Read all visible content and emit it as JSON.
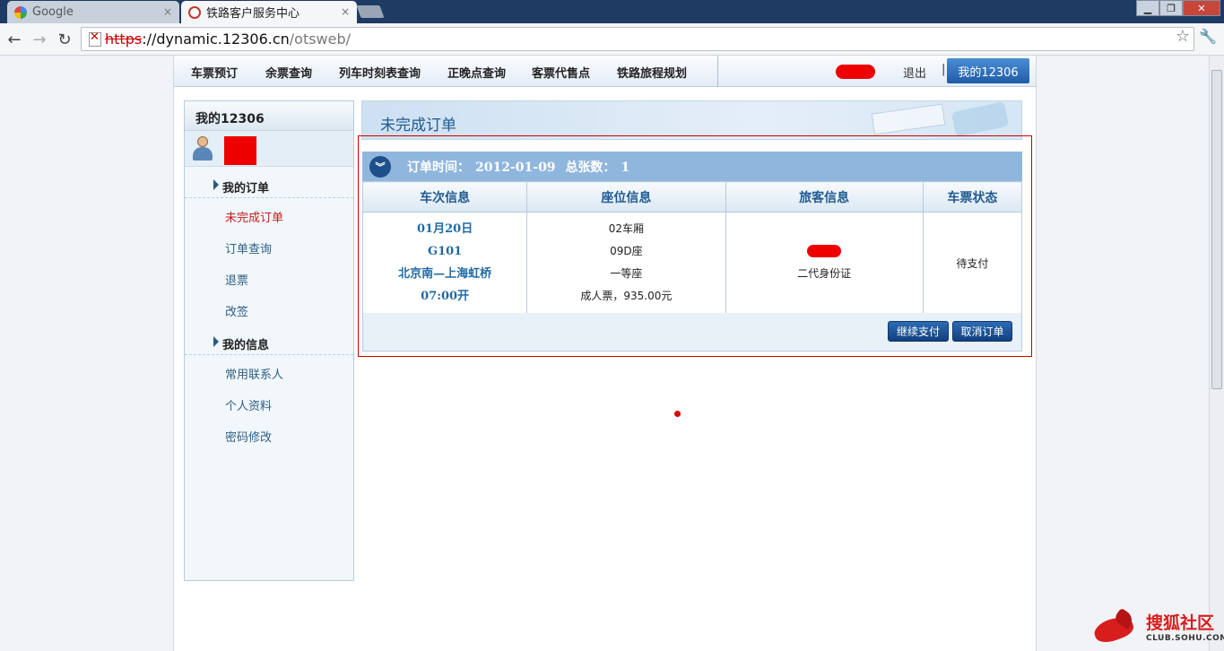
{
  "browser": {
    "tabs": [
      {
        "label": "Google",
        "active": false
      },
      {
        "label": "铁路客户服务中心",
        "active": true
      }
    ],
    "tab_close": "×",
    "window_buttons": {
      "minimize": "▁",
      "maximize": "❐",
      "close": "✕"
    },
    "nav": {
      "back": "←",
      "forward": "→",
      "reload": "↻"
    },
    "url": {
      "scheme": "https",
      "sep": "://",
      "host": "dynamic.12306.cn",
      "path": "/otsweb/"
    },
    "star": "☆",
    "wrench": "🔧"
  },
  "topmenu": {
    "items": [
      "车票预订",
      "余票查询",
      "列车时刻表查询",
      "正晚点查询",
      "客票代售点",
      "铁路旅程规划"
    ],
    "logout": "退出",
    "pipe": "|",
    "my12306": "我的12306"
  },
  "sidebar": {
    "title": "我的12306",
    "sections": [
      {
        "label": "我的订单",
        "links": [
          {
            "label": "未完成订单",
            "current": true
          },
          {
            "label": "订单查询",
            "current": false
          },
          {
            "label": "退票",
            "current": false
          },
          {
            "label": "改签",
            "current": false
          }
        ]
      },
      {
        "label": "我的信息",
        "links": [
          {
            "label": "常用联系人",
            "current": false
          },
          {
            "label": "个人资料",
            "current": false
          },
          {
            "label": "密码修改",
            "current": false
          }
        ]
      }
    ]
  },
  "main": {
    "title": "未完成订单",
    "order_bar": {
      "time_label": "订单时间：",
      "time_value": "2012-01-09",
      "count_label": "总张数：",
      "count_value": "1",
      "expand_glyph": "︾"
    },
    "table": {
      "headers": [
        "车次信息",
        "座位信息",
        "旅客信息",
        "车票状态"
      ],
      "row": {
        "train": [
          "01月20日",
          "G101",
          "北京南—上海虹桥",
          "07:00开"
        ],
        "seat": [
          "02车厢",
          "09D座",
          "一等座",
          "成人票，935.00元"
        ],
        "passenger_id": "二代身份证",
        "status": "待支付"
      }
    },
    "buttons": {
      "pay": "继续支付",
      "cancel": "取消订单"
    }
  },
  "watermark": {
    "text": "搜狐社区",
    "sub": "CLUB.SOHU.COM"
  },
  "colors": {
    "accent": "#1f5a92",
    "redaction": "#ee0000",
    "highlight_border": "#cc0000"
  }
}
